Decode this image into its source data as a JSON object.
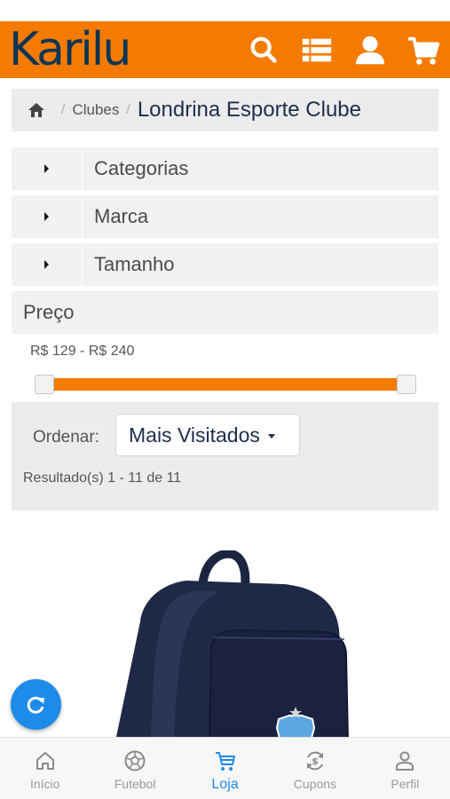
{
  "header": {
    "logo_text": "Karilu",
    "brand_color": "#f47b00",
    "logo_color": "#0b3556",
    "icons": [
      "search-icon",
      "list-icon",
      "user-icon",
      "cart-icon"
    ]
  },
  "breadcrumb": {
    "home_icon": "home-icon",
    "items": [
      "Clubes"
    ],
    "current": "Londrina Esporte Clube"
  },
  "filters": {
    "facets": [
      {
        "label": "Categorias"
      },
      {
        "label": "Marca"
      },
      {
        "label": "Tamanho"
      }
    ],
    "price": {
      "label": "Preço",
      "range_text": "R$ 129 - R$ 240",
      "min": 129,
      "max": 240
    }
  },
  "sort": {
    "label": "Ordenar:",
    "selected": "Mais Visitados",
    "results_text": "Resultado(s) 1 - 11 de 11"
  },
  "fab": {
    "icon": "refresh-icon",
    "color": "#1e8be8"
  },
  "tabbar": {
    "active_color": "#1e8be8",
    "items": [
      {
        "label": "Início",
        "icon": "home-icon"
      },
      {
        "label": "Futebol",
        "icon": "soccer-ball-icon"
      },
      {
        "label": "Loja",
        "icon": "cart-icon",
        "active": true
      },
      {
        "label": "Cupons",
        "icon": "coupon-icon"
      },
      {
        "label": "Perfil",
        "icon": "user-icon"
      }
    ]
  }
}
